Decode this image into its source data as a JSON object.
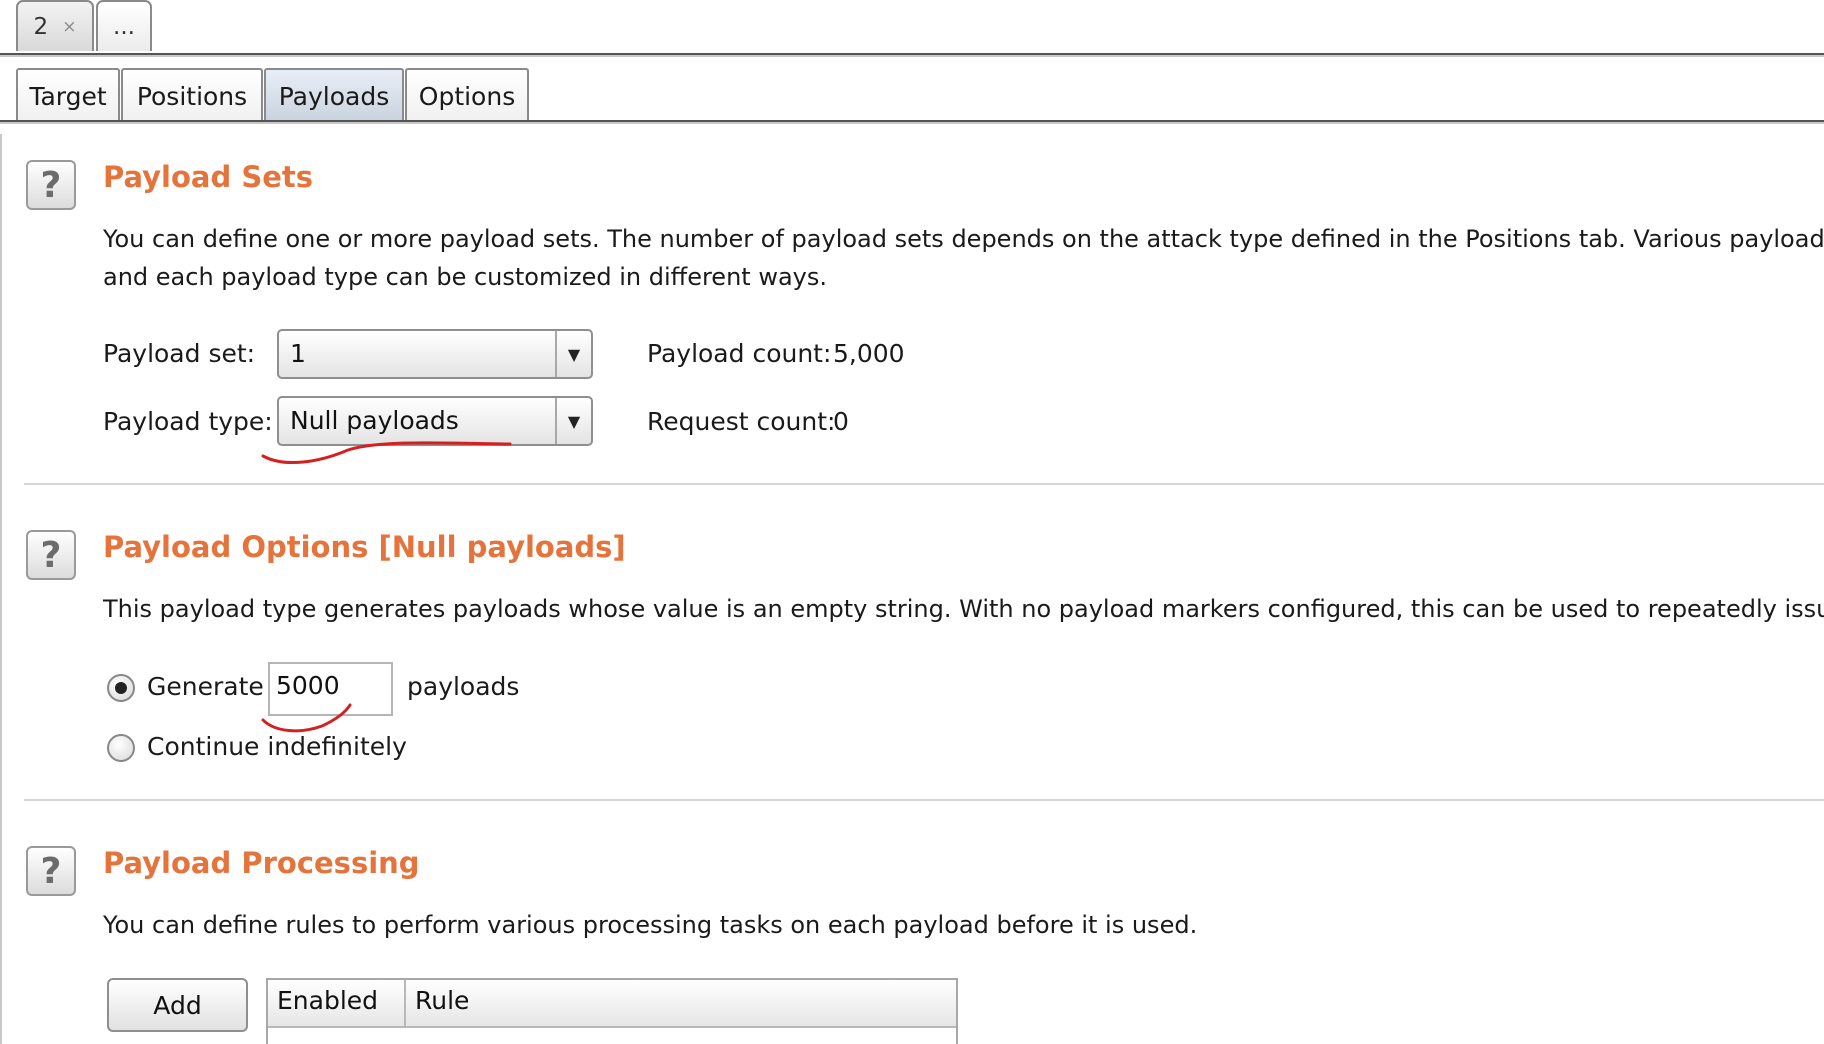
{
  "attack_tabs": [
    {
      "label": "2",
      "close": "×"
    },
    {
      "label": "..."
    }
  ],
  "sub_tabs": [
    "Target",
    "Positions",
    "Payloads",
    "Options"
  ],
  "active_sub_tab": "Payloads",
  "help_glyph": "?",
  "payload_sets": {
    "title": "Payload Sets",
    "desc_line1": "You can define one or more payload sets. The number of payload sets depends on the attack type defined in the Positions tab. Various payload type",
    "desc_line2": "and each payload type can be customized in different ways.",
    "set_label": "Payload set:",
    "set_value": "1",
    "type_label": "Payload type:",
    "type_value": "Null payloads",
    "payload_count_label": "Payload count:",
    "payload_count_value": "5,000",
    "request_count_label": "Request count:",
    "request_count_value": "0"
  },
  "payload_options": {
    "title": "Payload Options [Null payloads]",
    "desc": "This payload type generates payloads whose value is an empty string. With no payload markers configured, this can be used to repeatedly issue the",
    "generate_label": "Generate",
    "generate_value": "5000",
    "payloads_suffix": "payloads",
    "continue_label": "Continue indefinitely",
    "selected": "generate"
  },
  "payload_processing": {
    "title": "Payload Processing",
    "desc": "You can define rules to perform various processing tasks on each payload before it is used.",
    "add_button": "Add",
    "columns": [
      "Enabled",
      "Rule"
    ]
  },
  "colors": {
    "section_title": "#e5733c",
    "annotation": "#d42020"
  }
}
